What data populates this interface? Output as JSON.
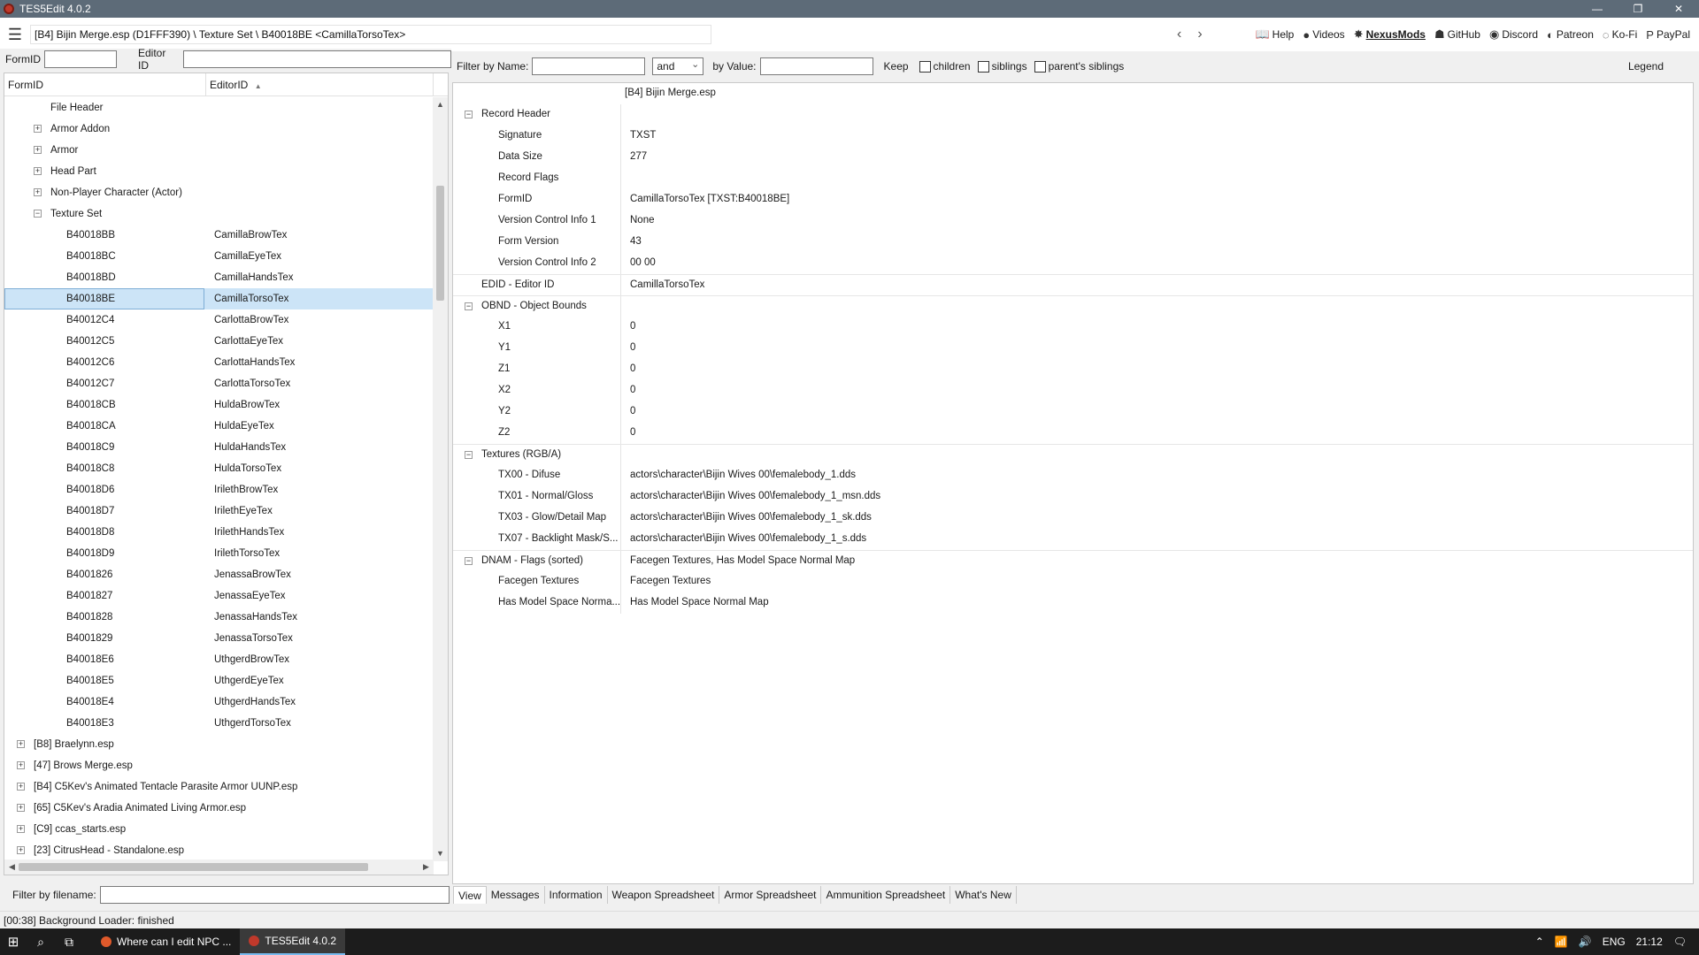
{
  "window": {
    "title": "TES5Edit 4.0.2",
    "controls": [
      "—",
      "❐",
      "✕"
    ]
  },
  "toolbar": {
    "path": "[B4] Bijin Merge.esp (D1FFF390) \\ Texture Set \\ B40018BE <CamillaTorsoTex>",
    "links": [
      {
        "icon": "📖",
        "label": "Help"
      },
      {
        "icon": "●",
        "label": "Videos"
      },
      {
        "icon": "✸",
        "label": "NexusMods"
      },
      {
        "icon": "☗",
        "label": "GitHub"
      },
      {
        "icon": "◉",
        "label": "Discord"
      },
      {
        "icon": "◐",
        "label": "Patreon"
      },
      {
        "icon": "◌",
        "label": "Ko-Fi"
      },
      {
        "icon": "P",
        "label": "PayPal"
      }
    ]
  },
  "left_search": {
    "formid_label": "FormID",
    "editorid_label": "Editor ID",
    "formid_value": "",
    "editorid_value": ""
  },
  "tree": {
    "columns": [
      "FormID",
      "EditorID"
    ],
    "sort_indicator": "▲",
    "categories": [
      {
        "label": "File Header",
        "expand": ""
      },
      {
        "label": "Armor Addon",
        "expand": "+"
      },
      {
        "label": "Armor",
        "expand": "+"
      },
      {
        "label": "Head Part",
        "expand": "+"
      },
      {
        "label": "Non-Player Character (Actor)",
        "expand": "+"
      },
      {
        "label": "Texture Set",
        "expand": "−"
      }
    ],
    "records": [
      {
        "formid": "B40018BB",
        "editorid": "CamillaBrowTex"
      },
      {
        "formid": "B40018BC",
        "editorid": "CamillaEyeTex"
      },
      {
        "formid": "B40018BD",
        "editorid": "CamillaHandsTex"
      },
      {
        "formid": "B40018BE",
        "editorid": "CamillaTorsoTex"
      },
      {
        "formid": "B40012C4",
        "editorid": "CarlottaBrowTex"
      },
      {
        "formid": "B40012C5",
        "editorid": "CarlottaEyeTex"
      },
      {
        "formid": "B40012C6",
        "editorid": "CarlottaHandsTex"
      },
      {
        "formid": "B40012C7",
        "editorid": "CarlottaTorsoTex"
      },
      {
        "formid": "B40018CB",
        "editorid": "HuldaBrowTex"
      },
      {
        "formid": "B40018CA",
        "editorid": "HuldaEyeTex"
      },
      {
        "formid": "B40018C9",
        "editorid": "HuldaHandsTex"
      },
      {
        "formid": "B40018C8",
        "editorid": "HuldaTorsoTex"
      },
      {
        "formid": "B40018D6",
        "editorid": "IrilethBrowTex"
      },
      {
        "formid": "B40018D7",
        "editorid": "IrilethEyeTex"
      },
      {
        "formid": "B40018D8",
        "editorid": "IrilethHandsTex"
      },
      {
        "formid": "B40018D9",
        "editorid": "IrilethTorsoTex"
      },
      {
        "formid": "B4001826",
        "editorid": "JenassaBrowTex"
      },
      {
        "formid": "B4001827",
        "editorid": "JenassaEyeTex"
      },
      {
        "formid": "B4001828",
        "editorid": "JenassaHandsTex"
      },
      {
        "formid": "B4001829",
        "editorid": "JenassaTorsoTex"
      },
      {
        "formid": "B40018E6",
        "editorid": "UthgerdBrowTex"
      },
      {
        "formid": "B40018E5",
        "editorid": "UthgerdEyeTex"
      },
      {
        "formid": "B40018E4",
        "editorid": "UthgerdHandsTex"
      },
      {
        "formid": "B40018E3",
        "editorid": "UthgerdTorsoTex"
      }
    ],
    "selected_formid": "B40018BE",
    "files": [
      "[B8] Braelynn.esp",
      "[47] Brows Merge.esp",
      "[B4] C5Kev's Animated Tentacle Parasite Armor UUNP.esp",
      "[65] C5Kev's Aradia Animated Living Armor.esp",
      "[C9] ccas_starts.esp",
      "[23] CitrusHead - Standalone.esp"
    ]
  },
  "file_filter": {
    "label": "Filter by filename:",
    "value": ""
  },
  "right_filter": {
    "name_label": "Filter by Name:",
    "name_value": "",
    "operator": "and",
    "value_label": "by Value:",
    "value_value": "",
    "keep_label": "Keep",
    "children_label": "children",
    "siblings_label": "siblings",
    "parents_siblings_label": "parent's siblings",
    "legend_label": "Legend"
  },
  "record": {
    "file_header": "[B4] Bijin Merge.esp",
    "rows": [
      {
        "key": "Record Header",
        "value": "",
        "level": 0,
        "expand": "−",
        "group": false
      },
      {
        "key": "Signature",
        "value": "TXST",
        "level": 1
      },
      {
        "key": "Data Size",
        "value": "277",
        "level": 1
      },
      {
        "key": "Record Flags",
        "value": "",
        "level": 1
      },
      {
        "key": "FormID",
        "value": "CamillaTorsoTex [TXST:B40018BE]",
        "level": 1
      },
      {
        "key": "Version Control Info 1",
        "value": "None",
        "level": 1
      },
      {
        "key": "Form Version",
        "value": "43",
        "level": 1
      },
      {
        "key": "Version Control Info 2",
        "value": "00 00",
        "level": 1
      },
      {
        "key": "EDID - Editor ID",
        "value": "CamillaTorsoTex",
        "level": 0,
        "group": true
      },
      {
        "key": "OBND - Object Bounds",
        "value": "",
        "level": 0,
        "expand": "−",
        "group": true
      },
      {
        "key": "X1",
        "value": "0",
        "level": 1
      },
      {
        "key": "Y1",
        "value": "0",
        "level": 1
      },
      {
        "key": "Z1",
        "value": "0",
        "level": 1
      },
      {
        "key": "X2",
        "value": "0",
        "level": 1
      },
      {
        "key": "Y2",
        "value": "0",
        "level": 1
      },
      {
        "key": "Z2",
        "value": "0",
        "level": 1
      },
      {
        "key": "Textures (RGB/A)",
        "value": "",
        "level": 0,
        "expand": "−",
        "group": true
      },
      {
        "key": "TX00 - Difuse",
        "value": "actors\\character\\Bijin Wives 00\\femalebody_1.dds",
        "level": 1
      },
      {
        "key": "TX01 - Normal/Gloss",
        "value": "actors\\character\\Bijin Wives 00\\femalebody_1_msn.dds",
        "level": 1
      },
      {
        "key": "TX03 - Glow/Detail Map",
        "value": "actors\\character\\Bijin Wives 00\\femalebody_1_sk.dds",
        "level": 1
      },
      {
        "key": "TX07 - Backlight Mask/S...",
        "value": "actors\\character\\Bijin Wives 00\\femalebody_1_s.dds",
        "level": 1
      },
      {
        "key": "DNAM - Flags (sorted)",
        "value": "Facegen Textures, Has Model Space Normal Map",
        "level": 0,
        "expand": "−",
        "group": true
      },
      {
        "key": "Facegen Textures",
        "value": "Facegen Textures",
        "level": 1
      },
      {
        "key": "Has Model Space Norma...",
        "value": "Has Model Space Normal Map",
        "level": 1
      }
    ]
  },
  "tabs": [
    "View",
    "Messages",
    "Information",
    "Weapon Spreadsheet",
    "Armor Spreadsheet",
    "Ammunition Spreadsheet",
    "What's New"
  ],
  "status": "[00:38] Background Loader: finished",
  "taskbar": {
    "tasks": [
      {
        "label": "Where can I edit NPC ...",
        "active": false
      },
      {
        "label": "TES5Edit 4.0.2",
        "active": true
      }
    ],
    "tray": {
      "lang": "ENG",
      "time": "21:12"
    }
  }
}
